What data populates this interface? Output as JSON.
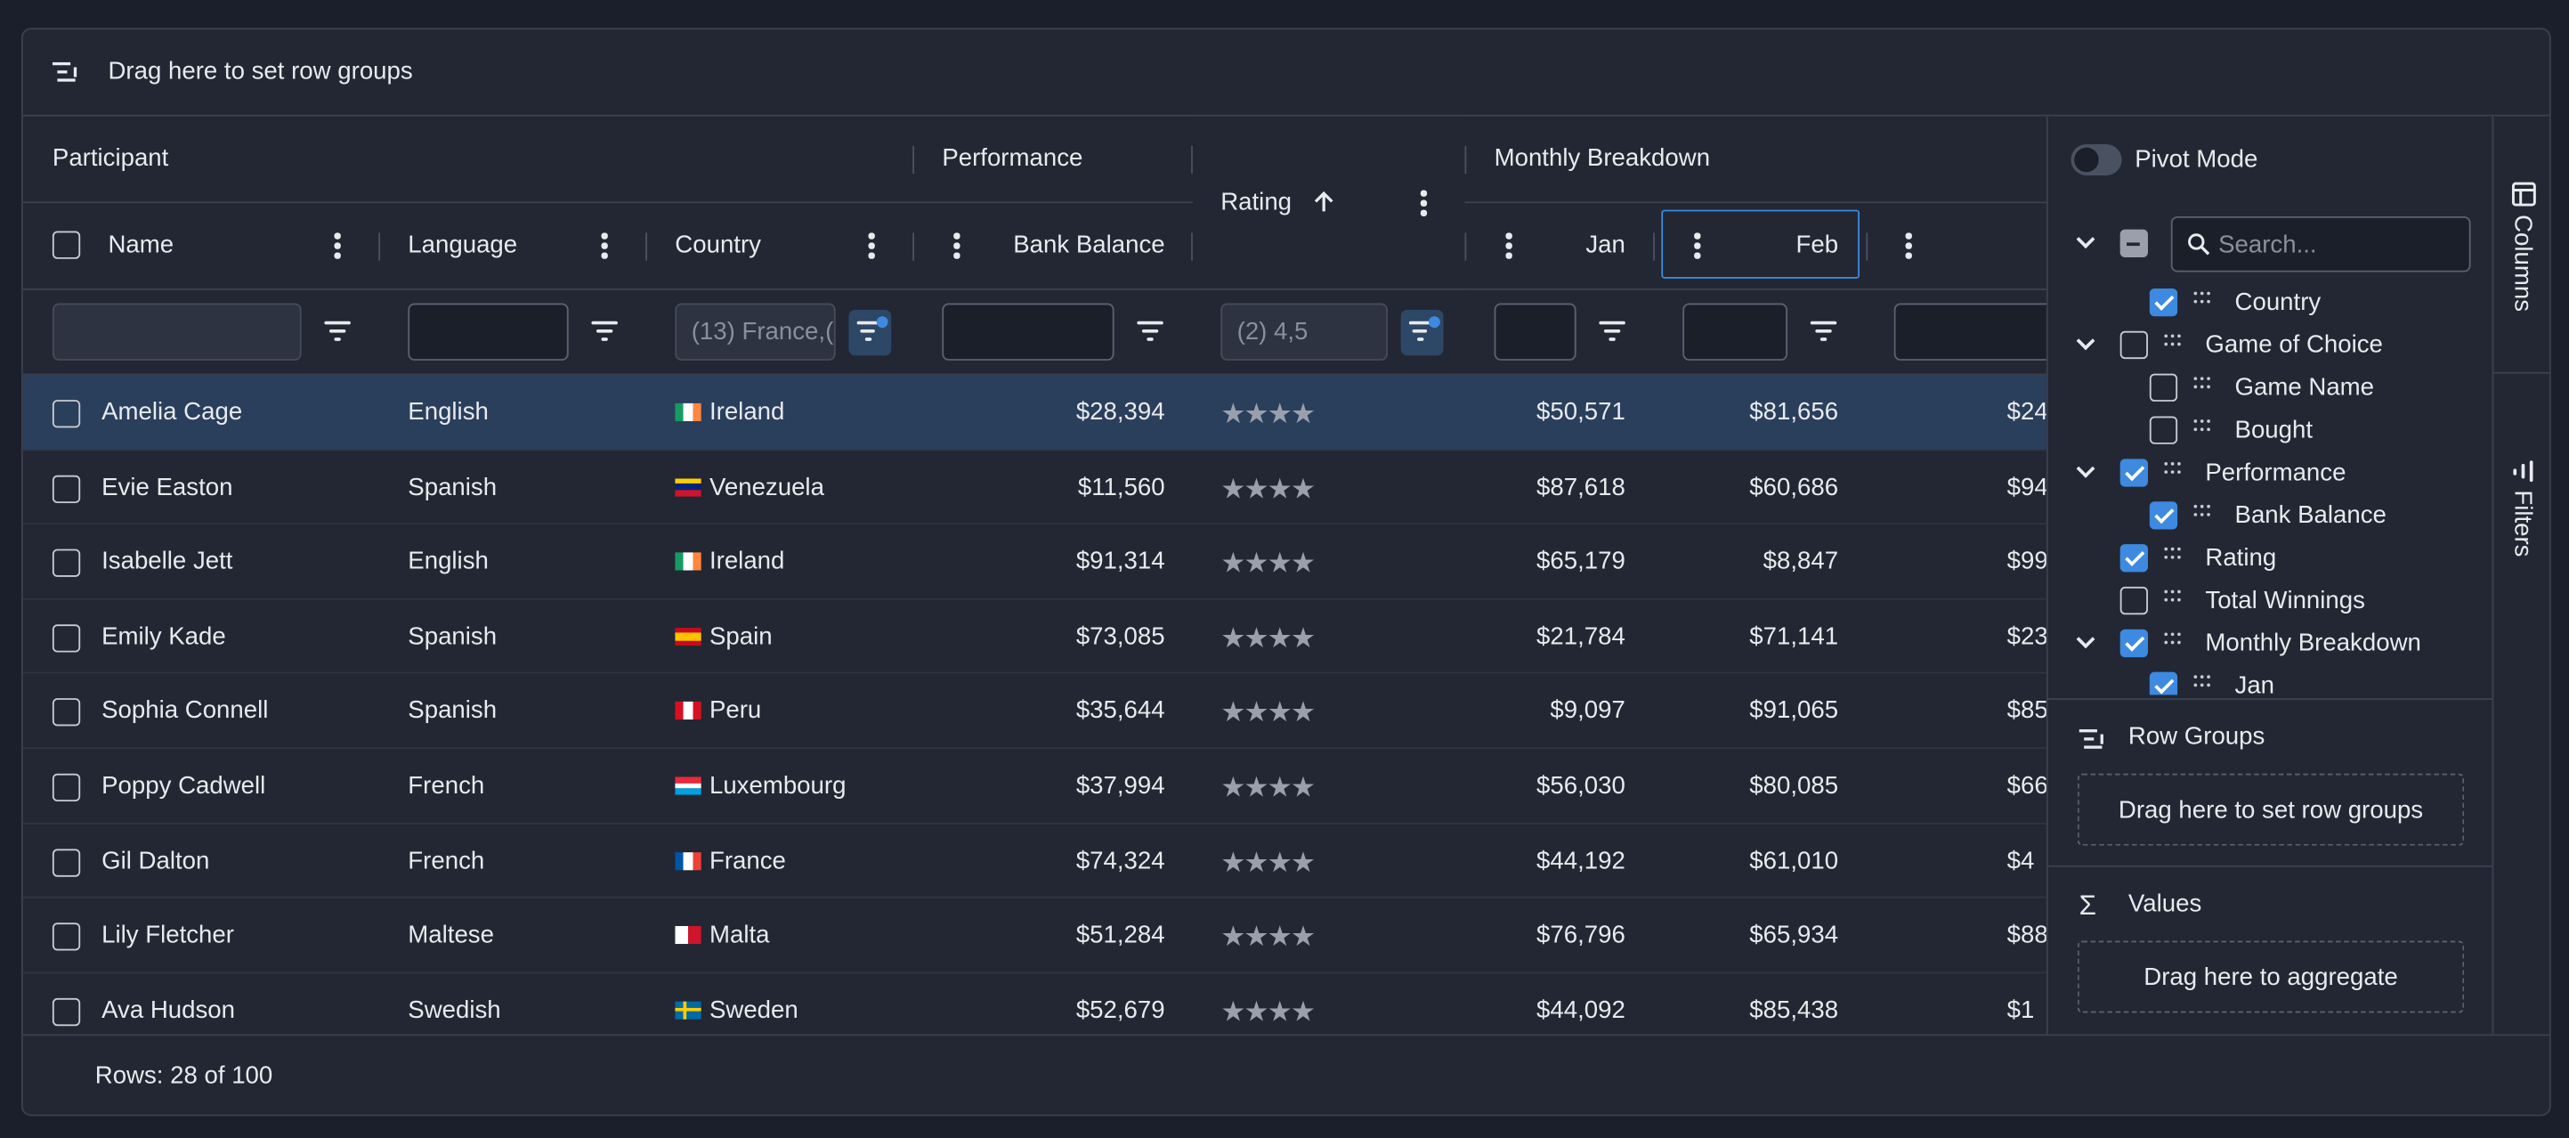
{
  "row_group_bar": {
    "label": "Drag here to set row groups"
  },
  "group_headers": {
    "participant": "Participant",
    "performance": "Performance",
    "monthly": "Monthly Breakdown"
  },
  "columns": {
    "name": "Name",
    "language": "Language",
    "country": "Country",
    "bank_balance": "Bank Balance",
    "rating": "Rating",
    "jan": "Jan",
    "feb": "Feb"
  },
  "filters": {
    "country": "(13) France,(",
    "rating": "(2) 4,5"
  },
  "rows": [
    {
      "name": "Amelia Cage",
      "language": "English",
      "country": "Ireland",
      "flag": "ie",
      "bank_balance": "$28,394",
      "rating": "★★★★",
      "jan": "$50,571",
      "feb": "$81,656",
      "next": "$24"
    },
    {
      "name": "Evie Easton",
      "language": "Spanish",
      "country": "Venezuela",
      "flag": "ve",
      "bank_balance": "$11,560",
      "rating": "★★★★",
      "jan": "$87,618",
      "feb": "$60,686",
      "next": "$94"
    },
    {
      "name": "Isabelle Jett",
      "language": "English",
      "country": "Ireland",
      "flag": "ie",
      "bank_balance": "$91,314",
      "rating": "★★★★",
      "jan": "$65,179",
      "feb": "$8,847",
      "next": "$99"
    },
    {
      "name": "Emily Kade",
      "language": "Spanish",
      "country": "Spain",
      "flag": "es",
      "bank_balance": "$73,085",
      "rating": "★★★★",
      "jan": "$21,784",
      "feb": "$71,141",
      "next": "$23"
    },
    {
      "name": "Sophia Connell",
      "language": "Spanish",
      "country": "Peru",
      "flag": "pe",
      "bank_balance": "$35,644",
      "rating": "★★★★",
      "jan": "$9,097",
      "feb": "$91,065",
      "next": "$85"
    },
    {
      "name": "Poppy Cadwell",
      "language": "French",
      "country": "Luxembourg",
      "flag": "lu",
      "bank_balance": "$37,994",
      "rating": "★★★★",
      "jan": "$56,030",
      "feb": "$80,085",
      "next": "$66"
    },
    {
      "name": "Gil Dalton",
      "language": "French",
      "country": "France",
      "flag": "fr",
      "bank_balance": "$74,324",
      "rating": "★★★★",
      "jan": "$44,192",
      "feb": "$61,010",
      "next": "$4"
    },
    {
      "name": "Lily Fletcher",
      "language": "Maltese",
      "country": "Malta",
      "flag": "mt",
      "bank_balance": "$51,284",
      "rating": "★★★★",
      "jan": "$76,796",
      "feb": "$65,934",
      "next": "$88"
    },
    {
      "name": "Ava Hudson",
      "language": "Swedish",
      "country": "Sweden",
      "flag": "se",
      "bank_balance": "$52,679",
      "rating": "★★★★",
      "jan": "$44,092",
      "feb": "$85,438",
      "next": "$1"
    }
  ],
  "footer": {
    "status": "Rows: 28 of 100"
  },
  "tool_panel": {
    "pivot_mode": "Pivot Mode",
    "search_placeholder": "Search...",
    "columns": [
      "Country",
      "Game of Choice",
      "Game Name",
      "Bought",
      "Performance",
      "Bank Balance",
      "Rating",
      "Total Winnings",
      "Monthly Breakdown",
      "Jan"
    ],
    "row_groups_title": "Row Groups",
    "row_groups_drop": "Drag here to set row groups",
    "values_title": "Values",
    "values_drop": "Drag here to aggregate"
  },
  "side_tabs": {
    "columns": "Columns",
    "filters": "Filters"
  },
  "colors": {
    "accent": "#3d8ae0",
    "background": "#222733",
    "selected_row": "#2a3f5c"
  }
}
